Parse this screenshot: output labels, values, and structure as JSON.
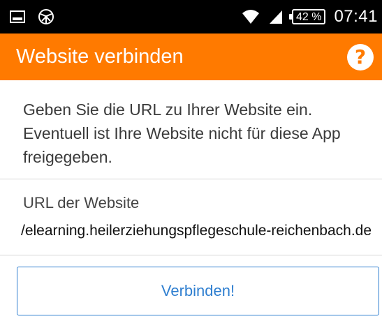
{
  "status_bar": {
    "icons": [
      "screenshot-icon",
      "aperture-icon",
      "wifi-icon",
      "signal-icon"
    ],
    "battery": "42 %",
    "time": "07:41"
  },
  "app_bar": {
    "title": "Website verbinden",
    "help_label": "?",
    "background": "#ff7a00"
  },
  "content": {
    "intro_text": "Geben Sie die URL zu Ihrer Website ein. Eventuell ist Ihre Website nicht für diese App freigegeben.",
    "url_label": "URL der Website",
    "url_value": "/elearning.heilerziehungspflegeschule-reichenbach.de",
    "connect_label": "Verbinden!"
  },
  "colors": {
    "accent": "#2f7fd0",
    "divider": "#d6d6d6"
  }
}
